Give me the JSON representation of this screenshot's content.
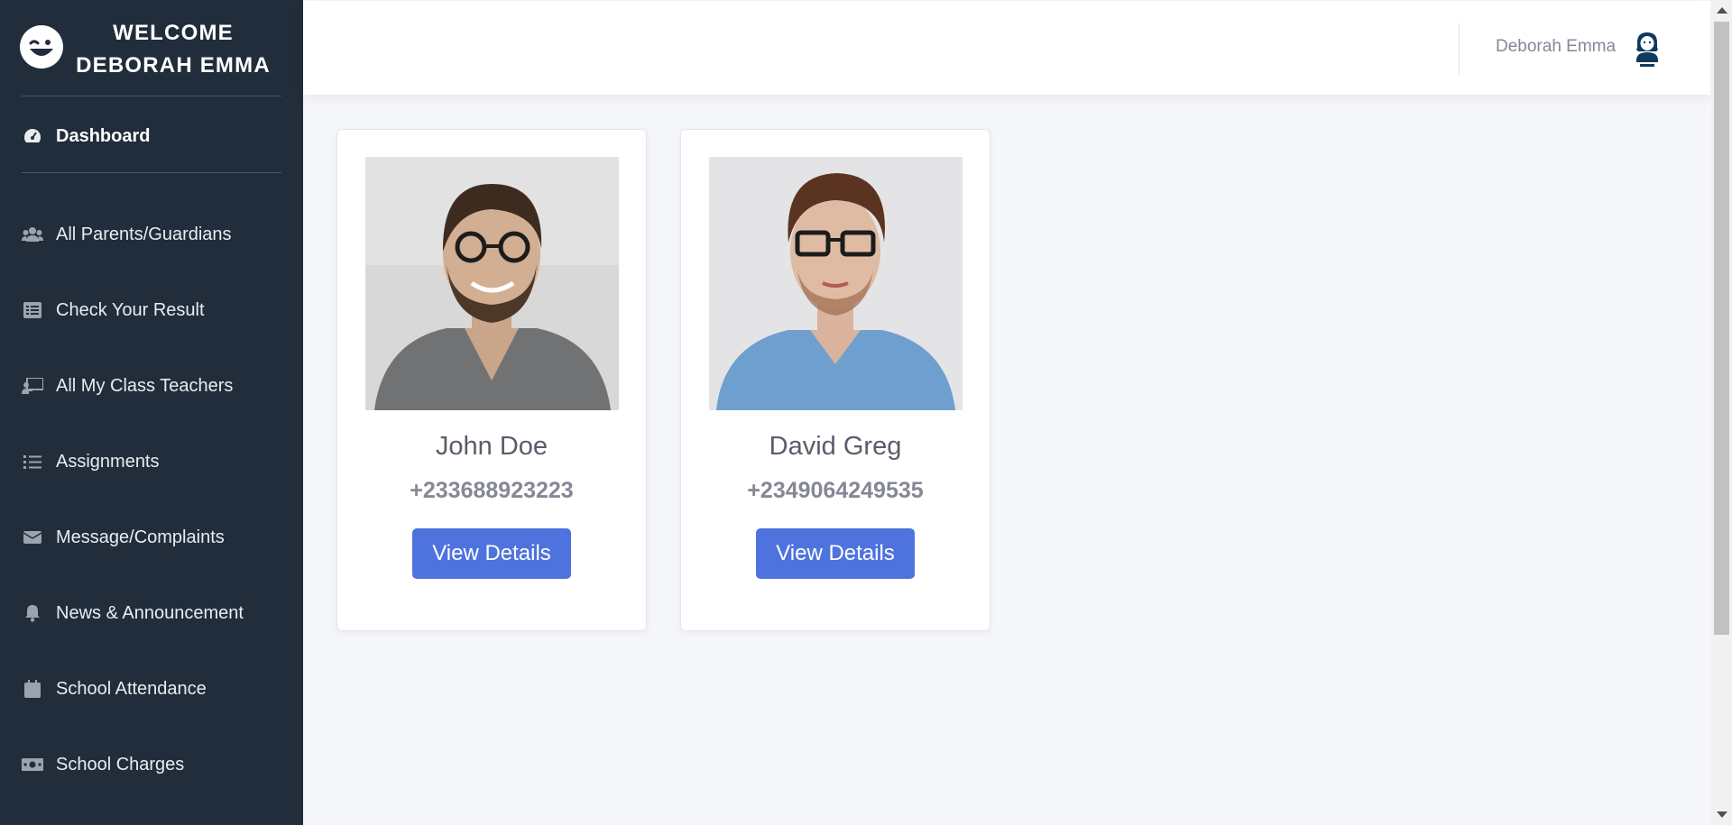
{
  "sidebar": {
    "brand": {
      "line1": "WELCOME",
      "line2": "DEBORAH EMMA",
      "logo_icon": "wink-face-icon"
    },
    "items": [
      {
        "label": "Dashboard",
        "icon": "tachometer-icon",
        "active": true
      },
      {
        "label": "All Parents/Guardians",
        "icon": "users-icon"
      },
      {
        "label": "Check Your Result",
        "icon": "list-alt-icon"
      },
      {
        "label": "All My Class Teachers",
        "icon": "chalkboard-teacher-icon"
      },
      {
        "label": "Assignments",
        "icon": "list-icon"
      },
      {
        "label": "Message/Complaints",
        "icon": "envelope-icon"
      },
      {
        "label": "News & Announcement",
        "icon": "bell-icon"
      },
      {
        "label": "School Attendance",
        "icon": "calendar-icon"
      },
      {
        "label": "School Charges",
        "icon": "money-bill-icon"
      }
    ]
  },
  "topbar": {
    "user_name": "Deborah Emma",
    "avatar_icon": "admin-avatar-icon"
  },
  "guardians": [
    {
      "name": "John Doe",
      "phone": "+233688923223",
      "button": "View Details"
    },
    {
      "name": "David Greg",
      "phone": "+2349064249535",
      "button": "View Details"
    }
  ],
  "colors": {
    "sidebar_bg": "#212d3b",
    "primary": "#4e73df",
    "content_bg": "#f5f6fa",
    "muted_text": "#858796"
  }
}
